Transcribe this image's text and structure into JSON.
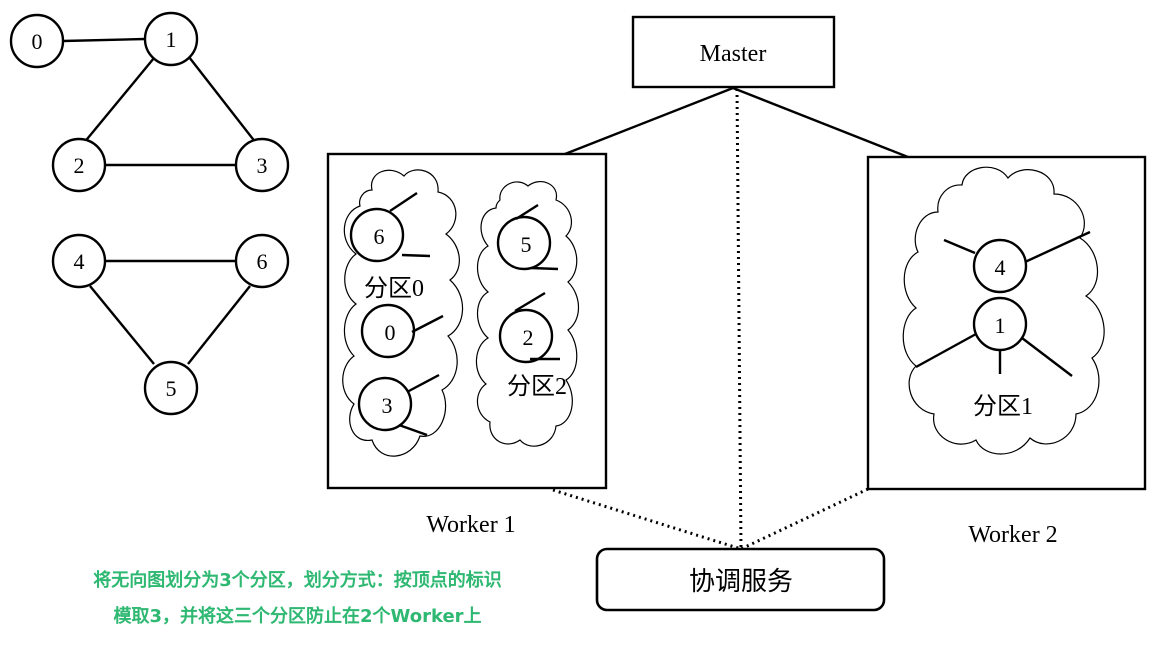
{
  "graph": {
    "nodes": [
      {
        "id": "0",
        "label": "0"
      },
      {
        "id": "1",
        "label": "1"
      },
      {
        "id": "2",
        "label": "2"
      },
      {
        "id": "3",
        "label": "3"
      },
      {
        "id": "4",
        "label": "4"
      },
      {
        "id": "5",
        "label": "5"
      },
      {
        "id": "6",
        "label": "6"
      }
    ],
    "edges": [
      [
        "0",
        "1"
      ],
      [
        "1",
        "2"
      ],
      [
        "1",
        "3"
      ],
      [
        "2",
        "3"
      ],
      [
        "4",
        "6"
      ],
      [
        "4",
        "5"
      ],
      [
        "6",
        "5"
      ]
    ]
  },
  "master": {
    "label": "Master"
  },
  "coordination": {
    "label": "协调服务"
  },
  "workers": [
    {
      "label": "Worker 1",
      "partitions": [
        {
          "label": "分区0",
          "vertices": [
            "6",
            "0",
            "3"
          ]
        },
        {
          "label": "分区2",
          "vertices": [
            "5",
            "2"
          ]
        }
      ]
    },
    {
      "label": "Worker 2",
      "partitions": [
        {
          "label": "分区1",
          "vertices": [
            "4",
            "1"
          ]
        }
      ]
    }
  ],
  "caption": {
    "line1": "将无向图划分为3个分区，划分方式：按顶点的标识",
    "line2": "模取3，并将这三个分区防止在2个Worker上"
  },
  "colors": {
    "caption": "#2eb872",
    "stroke": "#000000"
  }
}
